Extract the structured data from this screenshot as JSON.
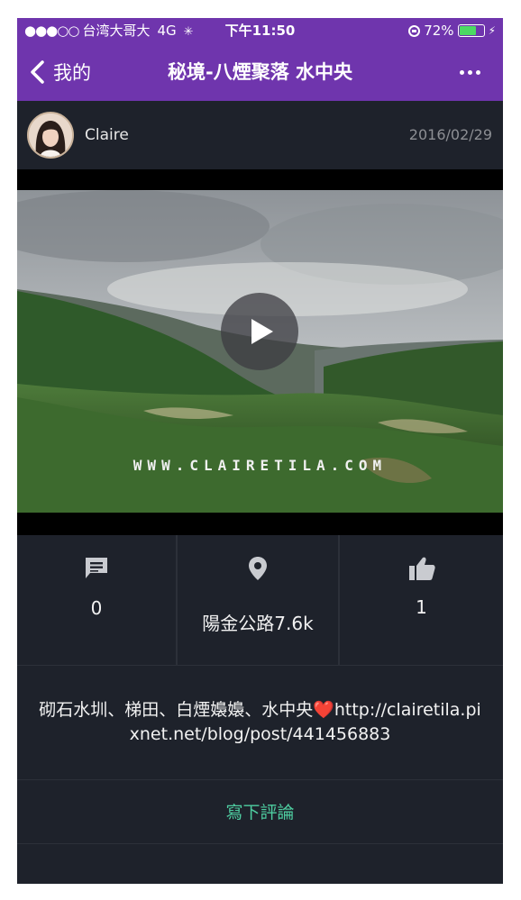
{
  "status_bar": {
    "signal": "●●●○○",
    "carrier": "台湾大哥大",
    "network": "4G",
    "time": "下午11:50",
    "battery": "72%",
    "battery_level": 0.72
  },
  "nav": {
    "back_label": "我的",
    "title": "秘境-八煙聚落 水中央"
  },
  "post": {
    "author": "Claire",
    "date": "2016/02/29",
    "watermark": "WWW.CLAIRETILA.COM"
  },
  "stats": {
    "comments": "0",
    "location": "陽金公路7.6k",
    "likes": "1"
  },
  "caption": {
    "text": "砌石水圳、梯田、白煙嬝嬝、水中央❤️http://clairetila.pixnet.net/blog/post/441456883"
  },
  "actions": {
    "write_comment": "寫下評論"
  },
  "icons": {
    "back": "chevron-left-icon",
    "more": "more-dots-icon",
    "play": "play-icon",
    "comment": "comment-icon",
    "location": "location-pin-icon",
    "like": "thumbs-up-icon"
  },
  "colors": {
    "brand": "#6f35ad",
    "background": "#1e222b",
    "accent": "#4ecda0",
    "battery_fill": "#4cd964"
  }
}
